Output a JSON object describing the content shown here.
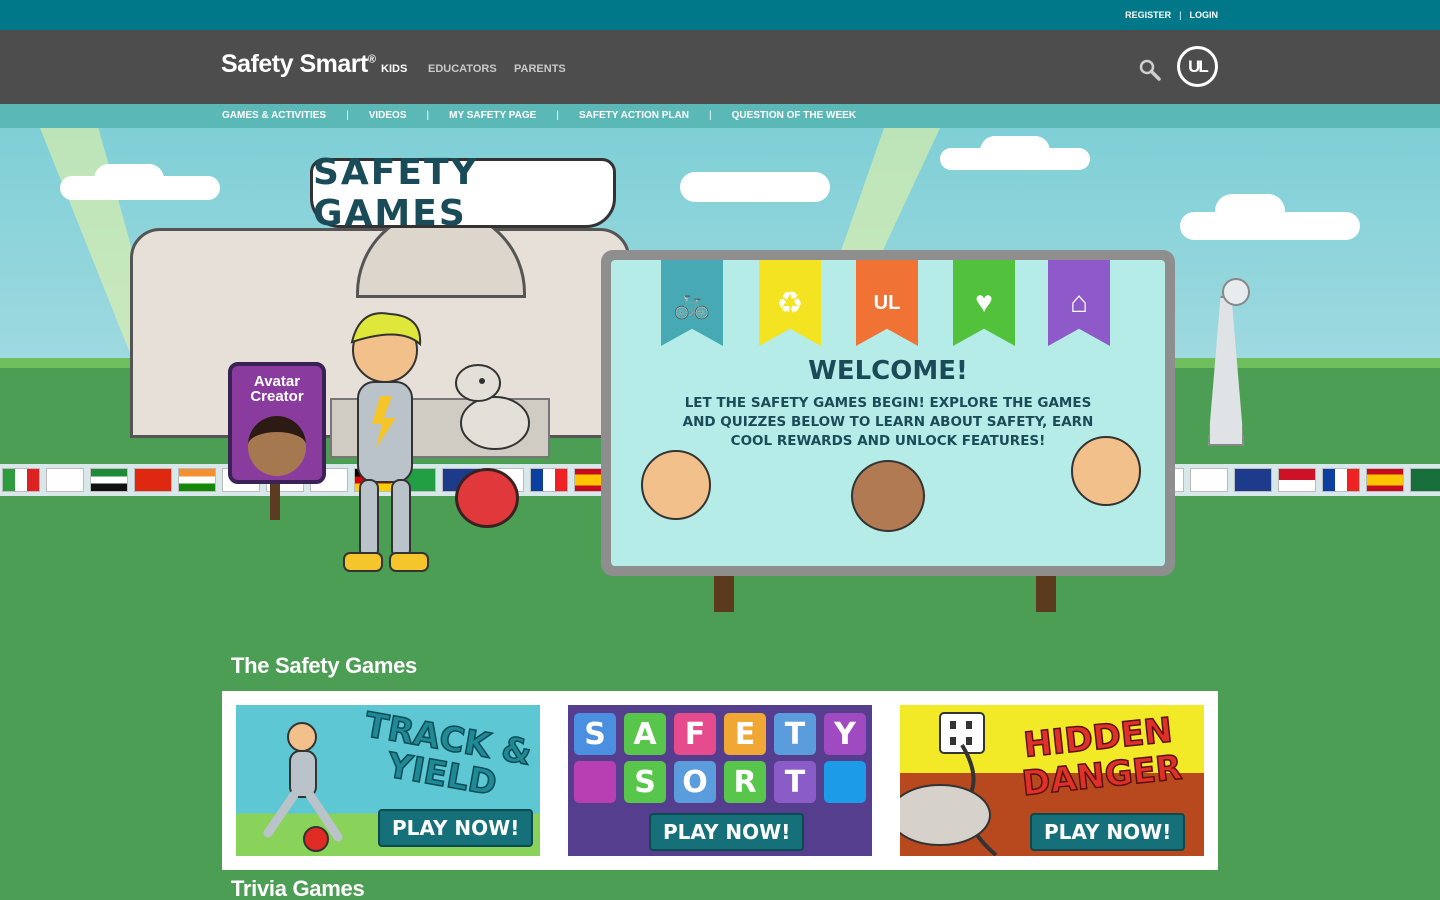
{
  "utility_bar": {
    "register": "REGISTER",
    "separator": "|",
    "login": "LOGIN"
  },
  "header": {
    "brand": "Safety Smart",
    "brand_mark": "®",
    "nav": {
      "kids": "KIDS",
      "educators": "EDUCATORS",
      "parents": "PARENTS"
    },
    "search_icon": "search-icon",
    "logo_text": "UL"
  },
  "sub_nav": {
    "items": [
      "GAMES & ACTIVITIES",
      "VIDEOS",
      "MY SAFETY PAGE",
      "SAFETY ACTION PLAN",
      "QUESTION OF THE WEEK"
    ],
    "separator": "|"
  },
  "hero": {
    "banner": "SAFETY GAMES",
    "avatar_sign": "Avatar Creator",
    "billboard": {
      "pennants": [
        {
          "icon": "bicycle-icon",
          "glyph": "🚲",
          "color": "#46a9b4"
        },
        {
          "icon": "recycle-icon",
          "glyph": "♻",
          "color": "#f3e320"
        },
        {
          "icon": "ul-icon",
          "glyph": "UL",
          "color": "#f07234"
        },
        {
          "icon": "heart-icon",
          "glyph": "♥",
          "color": "#52c23c"
        },
        {
          "icon": "house-icon",
          "glyph": "⌂",
          "color": "#8e59c9"
        }
      ],
      "title": "WELCOME!",
      "body": "LET THE SAFETY GAMES BEGIN! EXPLORE THE GAMES AND QUIZZES BELOW TO LEARN ABOUT SAFETY, EARN COOL REWARDS AND UNLOCK FEATURES!"
    }
  },
  "sections": {
    "safety_games": "The Safety Games",
    "trivia_games": "Trivia Games"
  },
  "games": [
    {
      "title": "TRACK & YIELD",
      "cta": "PLAY NOW!"
    },
    {
      "title_rows": [
        [
          "S",
          "A",
          "F",
          "E",
          "T",
          "Y"
        ],
        [
          "",
          "S",
          "O",
          "R",
          "T",
          ""
        ]
      ],
      "tile_colors": [
        [
          "#4a8fe0",
          "#57c64a",
          "#e64b8d",
          "#f0a733",
          "#5b9ddc",
          "#a04ac1"
        ],
        [
          "#b83fb3",
          "#57c64a",
          "#5b9ddc",
          "#57c64a",
          "#8a5cc7",
          "#1b9be8"
        ]
      ],
      "cta": "PLAY NOW!"
    },
    {
      "title": "HIDDEN DANGER",
      "cta": "PLAY NOW!"
    }
  ],
  "colors": {
    "utility_bar": "#00788a",
    "header": "#4d4d4d",
    "sub_nav": "#5ab9b6",
    "ground": "#4c9e55",
    "cta": "#15707a"
  }
}
